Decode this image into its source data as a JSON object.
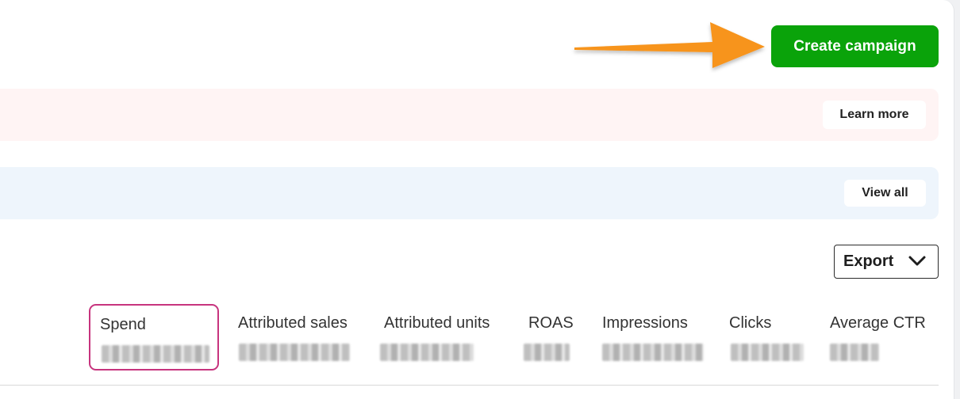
{
  "header": {
    "create_campaign_label": "Create campaign"
  },
  "banners": {
    "learn_more_label": "Learn more",
    "view_all_label": "View all"
  },
  "toolbar": {
    "export_label": "Export"
  },
  "metrics": {
    "items": [
      {
        "label": "Spend",
        "selected": true
      },
      {
        "label": "Attributed sales",
        "selected": false
      },
      {
        "label": "Attributed units",
        "selected": false
      },
      {
        "label": "ROAS",
        "selected": false
      },
      {
        "label": "Impressions",
        "selected": false
      },
      {
        "label": "Clicks",
        "selected": false
      },
      {
        "label": "Average CTR",
        "selected": false
      }
    ]
  },
  "colors": {
    "primary_green": "#0aa30a",
    "arrow_orange": "#f7941d",
    "selected_border": "#c7347e",
    "pink_banner": "#fff4f4",
    "blue_banner": "#eef5fc"
  },
  "icons": {
    "annotation_arrow": "arrow-right-icon",
    "export_chevron": "chevron-down-icon"
  }
}
